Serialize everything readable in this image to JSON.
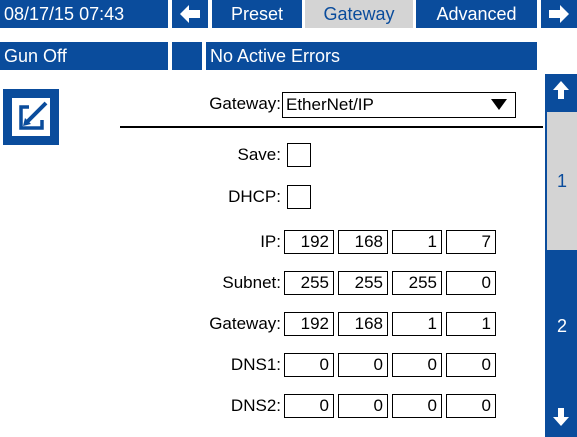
{
  "header": {
    "datetime": "08/17/15 07:43",
    "tabs": [
      {
        "label": "Preset",
        "active": false
      },
      {
        "label": "Gateway",
        "active": true
      },
      {
        "label": "Advanced",
        "active": false
      }
    ],
    "left_arrow_icon": "arrow-left-icon",
    "right_arrow_icon": "arrow-right-icon"
  },
  "status": {
    "gun_state": "Gun Off",
    "error_text": "No Active Errors"
  },
  "edit_icon": "edit-icon",
  "form": {
    "gateway_label": "Gateway:",
    "gateway_value": "EtherNet/IP",
    "save_label": "Save:",
    "dhcp_label": "DHCP:",
    "rows": [
      {
        "label": "IP:",
        "octets": [
          "192",
          "168",
          "1",
          "7"
        ]
      },
      {
        "label": "Subnet:",
        "octets": [
          "255",
          "255",
          "255",
          "0"
        ]
      },
      {
        "label": "Gateway:",
        "octets": [
          "192",
          "168",
          "1",
          "1"
        ]
      },
      {
        "label": "DNS1:",
        "octets": [
          "0",
          "0",
          "0",
          "0"
        ]
      },
      {
        "label": "DNS2:",
        "octets": [
          "0",
          "0",
          "0",
          "0"
        ]
      }
    ]
  },
  "pager": {
    "page1": "1",
    "page2": "2",
    "up_icon": "arrow-up-icon",
    "down_icon": "arrow-down-icon"
  },
  "colors": {
    "accent": "#0a4c9c",
    "inactive_tab": "#d4d4d4"
  }
}
